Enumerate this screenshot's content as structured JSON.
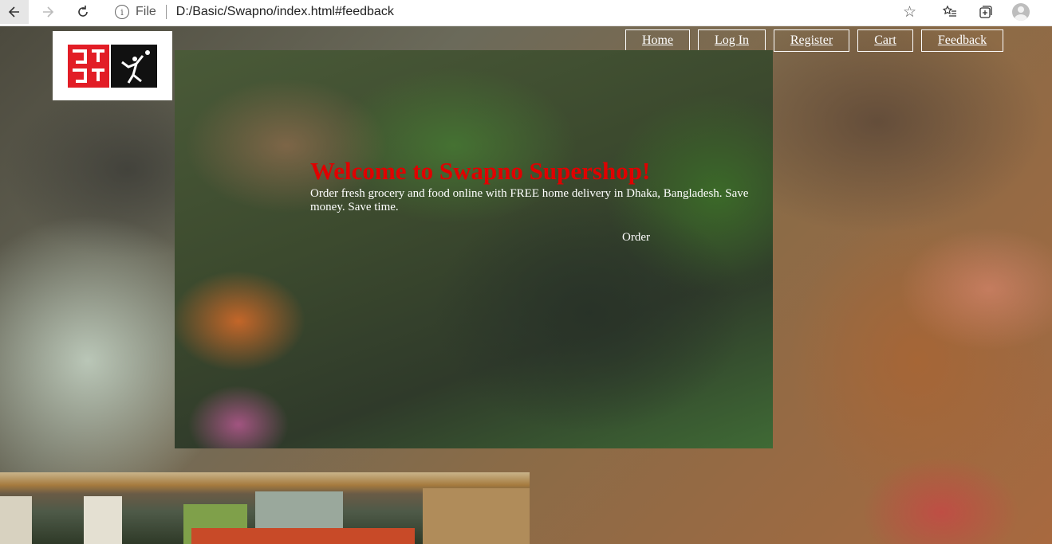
{
  "browser": {
    "scheme_label": "File",
    "url": "D:/Basic/Swapno/index.html#feedback"
  },
  "nav": {
    "items": [
      {
        "label": "Home"
      },
      {
        "label": "Log In"
      },
      {
        "label": "Register"
      },
      {
        "label": "Cart"
      },
      {
        "label": "Feedback"
      }
    ]
  },
  "hero": {
    "title": "Welcome to Swapno Supershop!",
    "subtitle": "Order fresh grocery and food online with FREE home delivery in Dhaka, Bangladesh. Save money. Save time.",
    "order_label": "Order"
  },
  "colors": {
    "title_red": "#e00000",
    "logo_red": "#e21d26"
  }
}
